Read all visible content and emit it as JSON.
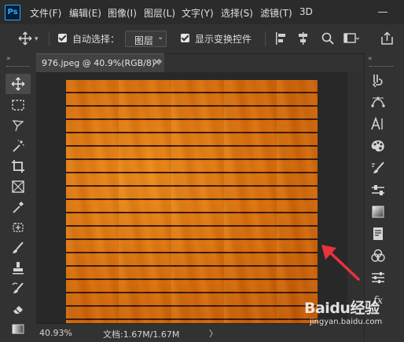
{
  "app": {
    "logo": "Ps"
  },
  "menu": {
    "items": [
      "文件(F)",
      "编辑(E)",
      "图像(I)",
      "图层(L)",
      "文字(Y)",
      "选择(S)",
      "滤镜(T)",
      "3D"
    ]
  },
  "options": {
    "auto_select_label": "自动选择：",
    "auto_select_value": "图层",
    "show_transform_label": "显示变换控件"
  },
  "document": {
    "tab_title": "976.jpeg @ 40.9%(RGB/8) *",
    "close_glyph": "×"
  },
  "status": {
    "zoom": "40.93%",
    "doc_info": "文档:1.67M/1.67M",
    "chevron": "〉"
  },
  "watermark": {
    "logo": "Baidu经验",
    "url": "jingyan.baidu.com"
  },
  "colors": {
    "accent": "#31a8ff",
    "annotation_arrow": "#e8323c",
    "wood": "#e07a12"
  },
  "icons": {
    "left_tools": [
      "move-tool-icon",
      "rectangular-marquee-icon",
      "lasso-icon",
      "magic-wand-icon",
      "crop-icon",
      "frame-icon",
      "eyedropper-icon",
      "healing-brush-icon",
      "brush-icon",
      "clone-stamp-icon",
      "history-brush-icon",
      "eraser-icon",
      "gradient-icon"
    ],
    "right_tools": [
      "history-icon",
      "paths-icon",
      "character-icon",
      "color-icon",
      "brushes-icon",
      "properties-icon",
      "gradients-icon",
      "libraries-icon",
      "channels-icon",
      "adjustments-icon",
      "fx-icon"
    ]
  }
}
